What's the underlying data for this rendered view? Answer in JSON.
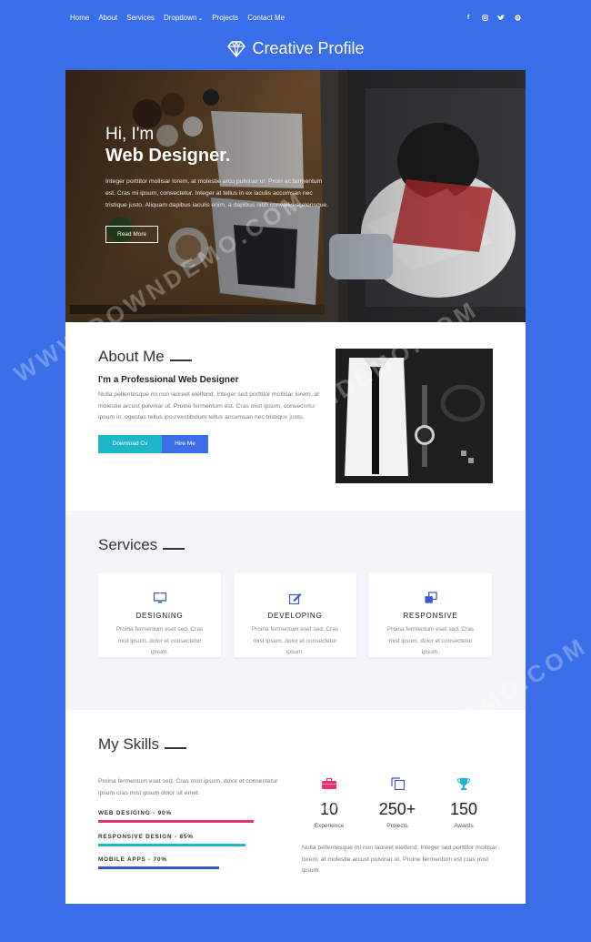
{
  "nav": {
    "links": [
      "Home",
      "About",
      "Services",
      "Dropdown",
      "Projects",
      "Contact Me"
    ],
    "dropdown_caret": "⌄",
    "social": [
      "facebook-icon",
      "instagram-icon",
      "twitter-icon",
      "dribbble-icon"
    ]
  },
  "brand": {
    "title": "Creative Profile",
    "icon": "diamond-icon"
  },
  "hero": {
    "greeting": "Hi, I'm",
    "title": "Web Designer.",
    "description": "Integer porttitor mollisar lorem, at molestie arcu pulvinar ut. Proin ac fermentum est. Cras mi ipsum, consectetur. Integer at tellus in ex iaculis accumsan nec tristique justo. Aliquam dapibus iaculis enim, a dapibus nibh convallis scelerisque.",
    "button": "Read More"
  },
  "about": {
    "title": "About Me",
    "subtitle": "I'm a Professional Web Designer",
    "description": "Nulla pellentesque mi non laoreet eleifend. Integer sed porttitor mollisar lorem, at molestie arcust pulvinar ut. Proine fermentum est. Cras mist ipsum, consectetur ipsum in, egestas tellus ipsu vestibulum tellus accumsan nec tristique justo.",
    "btn_download": "Download Cv",
    "btn_hire": "Hire Me"
  },
  "services": {
    "title": "Services",
    "items": [
      {
        "title": "DESIGNING",
        "icon": "monitor-icon",
        "description": "Proina fermentum eset sed. Cras mist ipsum, dolor et consectetur ipsum."
      },
      {
        "title": "DEVELOPING",
        "icon": "edit-icon",
        "description": "Proina fermentum eset sed. Cras mist ipsum, dolor et consectetur ipsum."
      },
      {
        "title": "RESPONSIVE",
        "icon": "clone-icon",
        "description": "Proina fermentum eset sed. Cras mist ipsum, dolor et consectetur ipsum."
      }
    ]
  },
  "skills": {
    "title": "My Skills",
    "description": "Proina fermentum eset sed. Cras mist ipsum, dolor et consectetur ipsum cras mist ipsum dolor sit emet.",
    "bars": [
      {
        "label": "WEB DESIGING - 90%",
        "percent": 90,
        "color": "#e8316e"
      },
      {
        "label": "RESPONSIVE DESIGN - 85%",
        "percent": 85,
        "color": "#1fb6c9"
      },
      {
        "label": "MOBILE APPS - 70%",
        "percent": 70,
        "color": "#3a56c7"
      }
    ],
    "stats": [
      {
        "number": "10",
        "label": "Experience",
        "icon": "briefcase-icon",
        "color": "#e8316e"
      },
      {
        "number": "250+",
        "label": "Projects",
        "icon": "clone-icon",
        "color": "#3a56c7"
      },
      {
        "number": "150",
        "label": "Awards",
        "icon": "trophy-icon",
        "color": "#1fb6c9"
      }
    ],
    "stats_description": "Nulla pellentesque mi non laoreet eleifend. Integer sed porttitor mollisar lorem, at molestie arcust pulvinar ut. Proine fermentum est cras mist ipsum."
  },
  "watermark": "WWW.DOWNDEMO.COM"
}
